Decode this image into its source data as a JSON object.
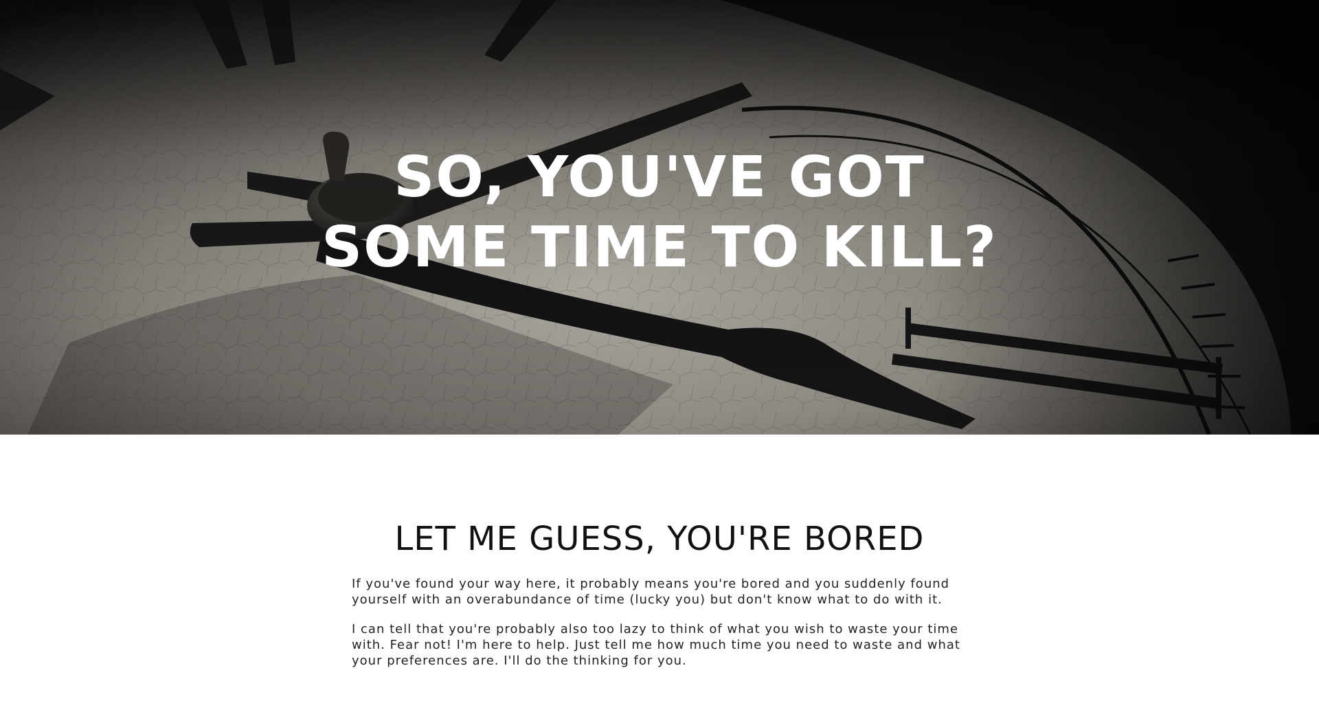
{
  "hero": {
    "title_line1": "SO, YOU'VE GOT",
    "title_line2": "SOME TIME TO KILL?"
  },
  "intro": {
    "heading": "LET ME GUESS, YOU'RE BORED",
    "paragraph1": "If you've found your way here, it probably means you're bored and you suddenly found yourself with an overabundance of time (lucky you) but don't know what to do with it.",
    "paragraph2": "I can tell that you're probably also too lazy to think of what you wish to waste your time with. Fear not! I'm here to help. Just tell me how much time you need to waste and what your preferences are. I'll do the thinking for you."
  }
}
